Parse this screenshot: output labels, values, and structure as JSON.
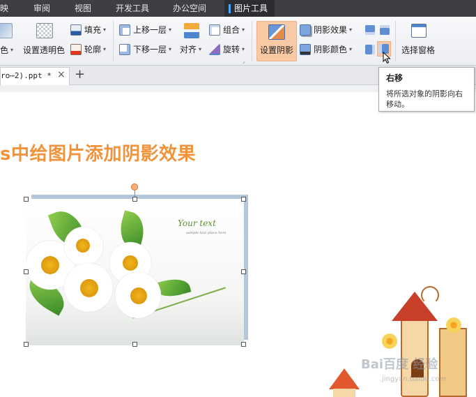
{
  "menu_tabs": [
    {
      "label": "映"
    },
    {
      "label": "审阅"
    },
    {
      "label": "视图"
    },
    {
      "label": "开发工具"
    },
    {
      "label": "办公空间"
    },
    {
      "label": "图片工具"
    }
  ],
  "ribbon": {
    "color_partial": "色",
    "set_transparent": "设置透明色",
    "fill": "填充",
    "outline": "轮廓",
    "bring_forward": "上移一层",
    "send_backward": "下移一层",
    "align": "对齐",
    "group": "组合",
    "rotate": "旋转",
    "set_shadow": "设置阴影",
    "shadow_effect": "阴影效果",
    "shadow_color": "阴影颜色",
    "selection_pane": "选择窗格"
  },
  "doc_tab": {
    "label": "ro⋯2).ppt *",
    "close": "×",
    "add": "+"
  },
  "slide": {
    "title": "s中给图片添加阴影效果"
  },
  "picture": {
    "script_text": "Your text",
    "small_text": "sample text place here"
  },
  "tooltip": {
    "title": "右移",
    "description": "将所选对象的阴影向右移动。"
  },
  "watermark": {
    "main": "Bai百度 经验",
    "sub": "jingyan.baidu.com"
  },
  "colors": {
    "title_orange": "#f0933a",
    "shadow_blue": "#b3c6dc",
    "set_shadow_active": "#f7c9a5",
    "menubar": "#3d3f44"
  }
}
